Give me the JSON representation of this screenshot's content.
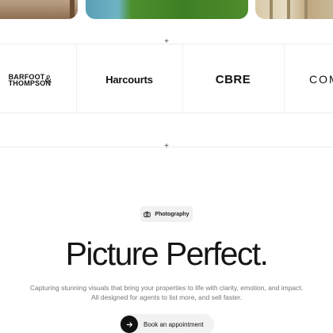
{
  "partners": {
    "barfoot_line1": "BARFOOT",
    "barfoot_amp": "&",
    "barfoot_line2": "THOMPSON",
    "harcourts": "Harcourts",
    "cbre": "CBRE",
    "partial": "COM"
  },
  "hero": {
    "badge_label": "Photography",
    "badge_icon": "camera-icon",
    "title": "Picture Perfect.",
    "subtitle_line1": "Capturing stunning visuals that bring your properties to life with clarity, emotion, and impact.",
    "subtitle_line2": "All designed for agents to list more, and sell faster.",
    "cta_label": "Book an appointment",
    "cta_icon": "arrow-right-icon"
  },
  "dividers": {
    "plus_icon": "plus-icon",
    "symbol": "+"
  },
  "colors": {
    "text": "#111111",
    "muted": "#777777",
    "cta_dark": "#111111",
    "chip_bg": "#f1f1f1"
  }
}
